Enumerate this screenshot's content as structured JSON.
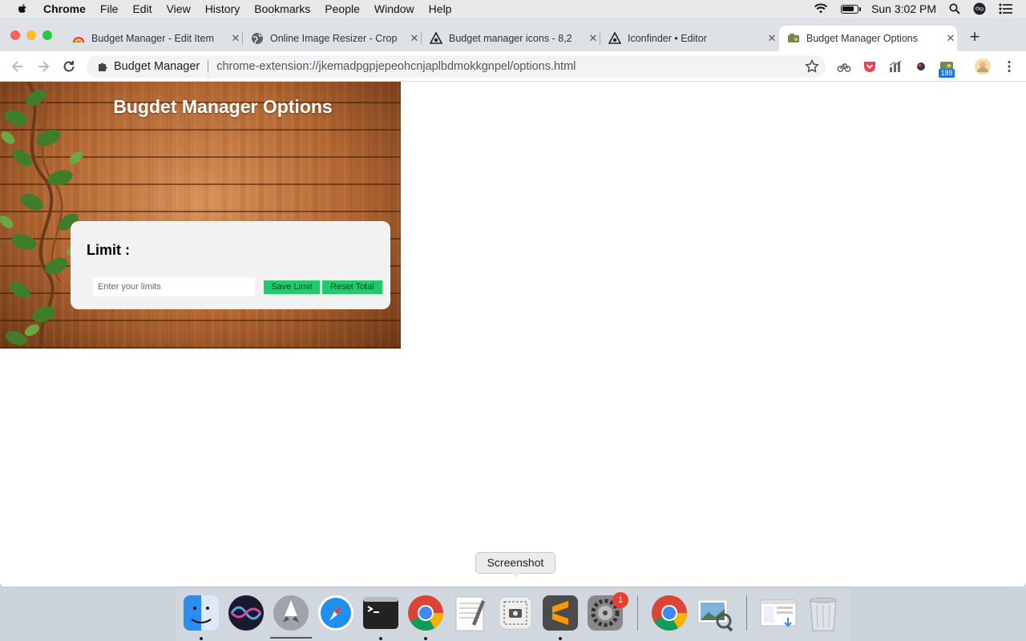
{
  "menubar": {
    "app_name": "Chrome",
    "items": [
      "File",
      "Edit",
      "View",
      "History",
      "Bookmarks",
      "People",
      "Window",
      "Help"
    ],
    "clock": "Sun 3:02 PM",
    "battery_level": 0.8
  },
  "tabs": [
    {
      "title": "Budget Manager - Edit Item",
      "icon": "rainbow-chart-icon"
    },
    {
      "title": "Online Image Resizer - Crop",
      "icon": "globe-icon"
    },
    {
      "title": "Budget manager icons - 8,2",
      "icon": "iconfinder-icon"
    },
    {
      "title": "Iconfinder • Editor",
      "icon": "iconfinder-icon"
    },
    {
      "title": "Budget Manager Options",
      "icon": "budget-manager-icon",
      "active": true
    }
  ],
  "omnibox": {
    "site_name": "Budget Manager",
    "url": "chrome-extension://jkemadpgpjepeohcnjaplbdmokkgnpel/options.html"
  },
  "extension_badge": "189",
  "page": {
    "title": "Bugdet Manager Options",
    "limit_label": "Limit :",
    "limit_placeholder": "Enter your limits",
    "save_button": "Save Limit",
    "reset_button": "Reset Total"
  },
  "dock": {
    "tooltip": "Screenshot",
    "badge_count": "1",
    "apps": [
      "Finder",
      "Siri",
      "Launchpad",
      "Safari",
      "Terminal",
      "Google Chrome",
      "TextEdit",
      "Screenshot",
      "Sublime Text",
      "System Preferences",
      "Google Chrome",
      "Preview",
      "Downloads",
      "Trash"
    ]
  },
  "colors": {
    "accent_button": "#1fcb6d",
    "card_bg": "#f2f2f2",
    "wood": "#b26632"
  }
}
